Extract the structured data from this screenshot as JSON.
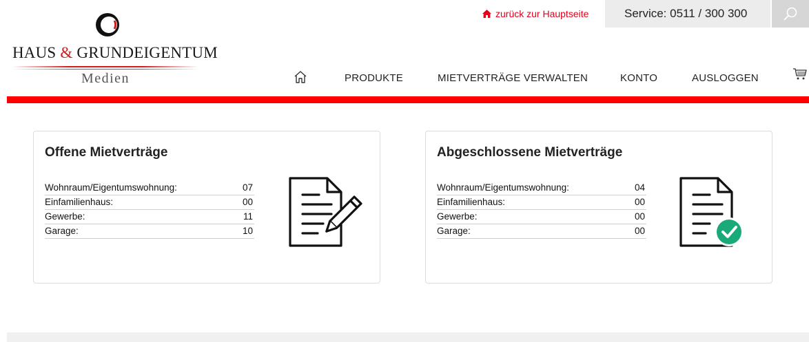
{
  "brand": {
    "logo_main_left": "HAUS",
    "logo_amp": "&",
    "logo_main_right": "GRUNDEIGENTUM",
    "logo_sub": "Medien"
  },
  "header": {
    "back_link": "zurück zur Hauptseite",
    "service": "Service: 0511 / 300 300",
    "accent_color": "#e3001b"
  },
  "nav": {
    "items": [
      {
        "label": "PRODUKTE"
      },
      {
        "label": "MIETVERTRÄGE VERWALTEN"
      },
      {
        "label": "KONTO"
      },
      {
        "label": "AUSLOGGEN"
      }
    ],
    "home_icon": "home-icon",
    "cart_icon": "cart-icon"
  },
  "cards": [
    {
      "title": "Offene Mietverträge",
      "icon": "document-edit-icon",
      "rows": [
        {
          "label": "Wohnraum/Eigentumswohnung:",
          "value": "07"
        },
        {
          "label": "Einfamilienhaus:",
          "value": "00"
        },
        {
          "label": "Gewerbe:",
          "value": "11"
        },
        {
          "label": "Garage:",
          "value": "10"
        }
      ]
    },
    {
      "title": "Abgeschlossene Mietverträge",
      "icon": "document-check-icon",
      "check_color": "#1aaa7a",
      "rows": [
        {
          "label": "Wohnraum/Eigentumswohnung:",
          "value": "04"
        },
        {
          "label": "Einfamilienhaus:",
          "value": "00"
        },
        {
          "label": "Gewerbe:",
          "value": "00"
        },
        {
          "label": "Garage:",
          "value": "00"
        }
      ]
    }
  ]
}
